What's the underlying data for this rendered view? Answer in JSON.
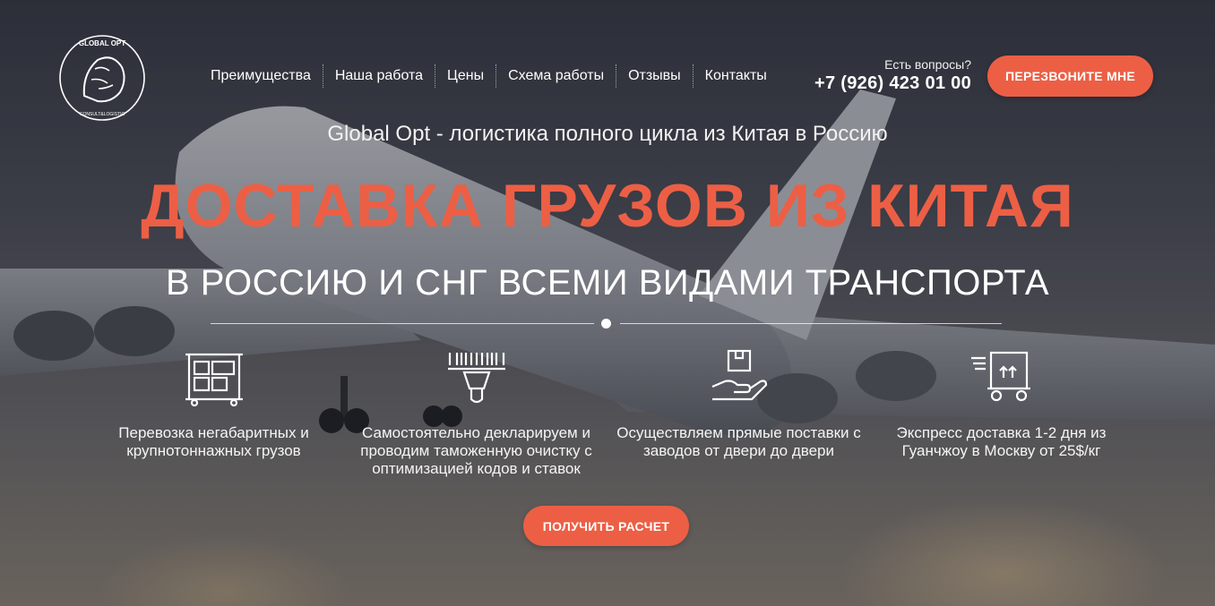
{
  "header": {
    "nav": [
      {
        "label": "Преимущества"
      },
      {
        "label": "Наша работа"
      },
      {
        "label": "Цены"
      },
      {
        "label": "Схема работы"
      },
      {
        "label": "Отзывы"
      },
      {
        "label": "Контакты"
      }
    ],
    "question": "Есть вопросы?",
    "phone": "+7 (926) 423 01 00",
    "callback_button": "ПЕРЕЗВОНИТЕ МНЕ"
  },
  "logo": {
    "top_text": "GLOBAL OPT",
    "bottom_text": "CONSULT&LOGISTIC"
  },
  "hero": {
    "subtitle": "Global Opt - логистика полного цикла из Китая в Россию",
    "headline": "ДОСТАВКА ГРУЗОВ ИЗ КИТАЯ",
    "headline2": "В РОССИЮ И СНГ ВСЕМИ ВИДАМИ ТРАНСПОРТА"
  },
  "features": [
    {
      "icon": "cargo-icon",
      "text": "Перевозка негабаритных и крупнотоннажных грузов"
    },
    {
      "icon": "barcode-scanner-icon",
      "text": "Самостоятельно декларируем и проводим таможенную очистку с оптимизацией кодов и ставок"
    },
    {
      "icon": "box-in-hand-icon",
      "text": "Осуществляем прямые поставки с заводов от двери до двери"
    },
    {
      "icon": "express-cart-icon",
      "text": "Экспресс доставка 1-2 дня из Гуанчжоу в Москву от 25$/кг"
    }
  ],
  "cta_button": "ПОЛУЧИТЬ РАСЧЕТ",
  "colors": {
    "accent": "#ec5f45",
    "text": "#ffffff"
  }
}
